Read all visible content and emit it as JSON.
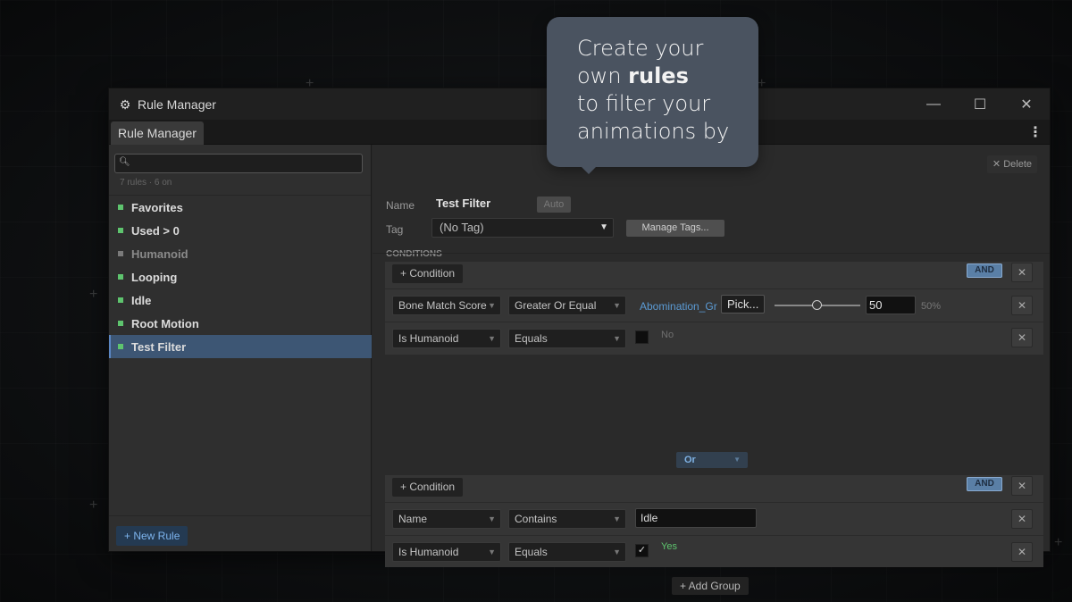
{
  "window": {
    "title": "Rule Manager",
    "tab": "Rule Manager",
    "controls": {
      "minimize": "—",
      "maximize": "☐",
      "close": "✕"
    },
    "menu_glyph": "⋮"
  },
  "sidebar": {
    "search": {
      "value": "",
      "placeholder": ""
    },
    "rules_count": "7 rules · 6 on",
    "rules": [
      {
        "label": "Favorites",
        "color": "#5ec46e",
        "enabled": true,
        "selected": false
      },
      {
        "label": "Used > 0",
        "color": "#5ec46e",
        "enabled": true,
        "selected": false
      },
      {
        "label": "Humanoid",
        "color": "#7a7a7a",
        "enabled": false,
        "selected": false
      },
      {
        "label": "Looping",
        "color": "#5ec46e",
        "enabled": true,
        "selected": false
      },
      {
        "label": "Idle",
        "color": "#5ec46e",
        "enabled": true,
        "selected": false
      },
      {
        "label": "Root Motion",
        "color": "#5ec46e",
        "enabled": true,
        "selected": false
      },
      {
        "label": "Test Filter",
        "color": "#5ec46e",
        "enabled": true,
        "selected": true
      }
    ],
    "new_rule_label": "+  New Rule"
  },
  "main": {
    "delete_label": "✕ Delete",
    "name_label": "Name",
    "name_value": "Test Filter",
    "auto_label": "Auto",
    "tag_label": "Tag",
    "tag_value": "(No Tag)",
    "manage_tags_label": "Manage Tags...",
    "conditions_label": "CONDITIONS",
    "groups": [
      {
        "add_condition_label": "+  Condition",
        "logic": "AND",
        "conditions": [
          {
            "field": "Bone Match Score",
            "op": "Greater Or Equal",
            "target": "Abomination_Gr",
            "pick_label": "Pick...",
            "value": "50",
            "percent": "50%",
            "slider_fraction": 0.5
          },
          {
            "field": "Is Humanoid",
            "op": "Equals",
            "checked": false,
            "check_label": "No"
          }
        ]
      },
      {
        "add_condition_label": "+  Condition",
        "logic": "AND",
        "conditions": [
          {
            "field": "Name",
            "op": "Contains",
            "text": "Idle"
          },
          {
            "field": "Is Humanoid",
            "op": "Equals",
            "checked": true,
            "check_label": "Yes"
          }
        ]
      }
    ],
    "group_joiner": "Or",
    "add_group_label": "+  Add Group"
  },
  "tooltip": {
    "line1": "Create your",
    "line2_prefix": "own ",
    "line2_bold": "rules",
    "line3": "to filter your",
    "line4": "animations by"
  },
  "colors": {
    "accent_blue": "#5b9bd5",
    "enabled_green": "#5ec46e",
    "yes_green": "#5ec46e",
    "selected_bg": "#3d5674"
  }
}
